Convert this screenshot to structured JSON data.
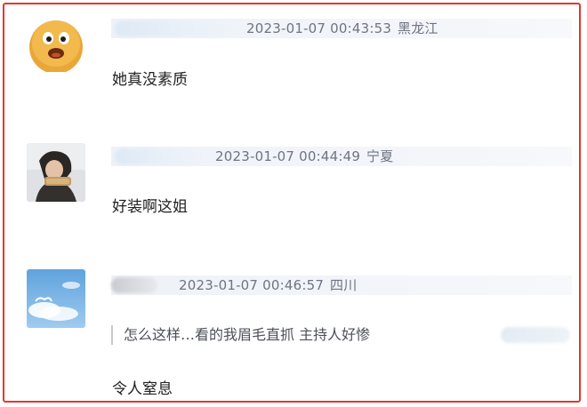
{
  "comments": [
    {
      "timestamp": "2023-01-07 00:43:53",
      "location": "黑龙江",
      "text": "她真没素质",
      "avatar_icon": "orange-face-avatar-icon"
    },
    {
      "timestamp": "2023-01-07 00:44:49",
      "location": "宁夏",
      "text": "好装啊这姐",
      "avatar_icon": "person-photo-avatar-icon"
    },
    {
      "timestamp": "2023-01-07 00:46:57",
      "location": "四川",
      "quote": "怎么这样…看的我眉毛直抓 主持人好惨",
      "text": "令人窒息",
      "avatar_icon": "sky-clouds-avatar-icon"
    }
  ],
  "colors": {
    "frame_border": "#e8352d",
    "meta_text": "#6f7480",
    "body_text": "#222222"
  }
}
